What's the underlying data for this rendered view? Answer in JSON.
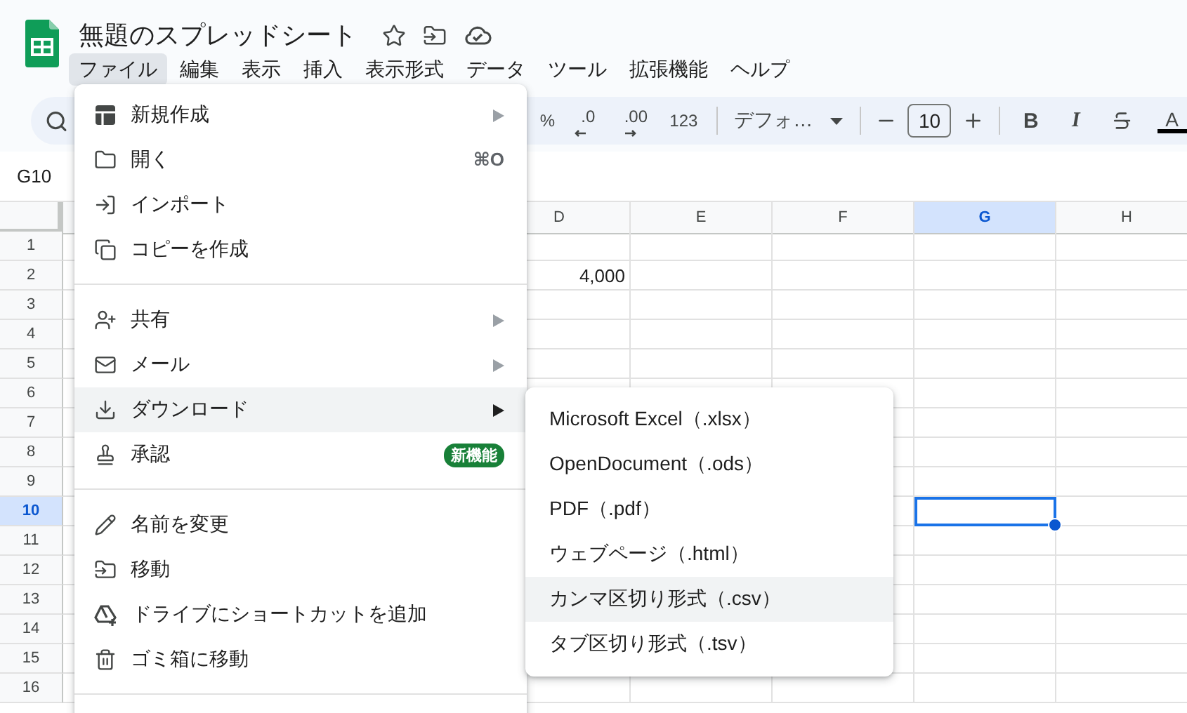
{
  "document": {
    "title": "無題のスプレッドシート"
  },
  "menu_bar": [
    {
      "label": "ファイル",
      "selected": true
    },
    {
      "label": "編集",
      "selected": false
    },
    {
      "label": "表示",
      "selected": false
    },
    {
      "label": "挿入",
      "selected": false
    },
    {
      "label": "表示形式",
      "selected": false
    },
    {
      "label": "データ",
      "selected": false
    },
    {
      "label": "ツール",
      "selected": false
    },
    {
      "label": "拡張機能",
      "selected": false
    },
    {
      "label": "ヘルプ",
      "selected": false
    }
  ],
  "toolbar": {
    "percent": "%",
    "decrease_decimals": ".0",
    "increase_decimals": ".00",
    "number_format": "123",
    "font": "デフォ…",
    "font_size": "10",
    "bold": "B",
    "italic": "I",
    "text_color": "A"
  },
  "name_box": "G10",
  "sheet": {
    "columns": [
      {
        "label": "D",
        "selected": false
      },
      {
        "label": "E",
        "selected": false
      },
      {
        "label": "F",
        "selected": false
      },
      {
        "label": "G",
        "selected": true
      },
      {
        "label": "H",
        "selected": false
      }
    ],
    "rows": [
      {
        "label": "1",
        "selected": false
      },
      {
        "label": "2",
        "selected": false,
        "cells": [
          "4,000"
        ]
      },
      {
        "label": "3",
        "selected": false
      },
      {
        "label": "4",
        "selected": false
      },
      {
        "label": "5",
        "selected": false
      },
      {
        "label": "6",
        "selected": false
      },
      {
        "label": "7",
        "selected": false
      },
      {
        "label": "8",
        "selected": false
      },
      {
        "label": "9",
        "selected": false
      },
      {
        "label": "10",
        "selected": true
      },
      {
        "label": "11",
        "selected": false
      },
      {
        "label": "12",
        "selected": false
      },
      {
        "label": "13",
        "selected": false
      },
      {
        "label": "14",
        "selected": false
      },
      {
        "label": "15",
        "selected": false
      },
      {
        "label": "16",
        "selected": false
      }
    ]
  },
  "file_menu": [
    {
      "kind": "item",
      "label": "新規作成",
      "submenu": true,
      "selected": false
    },
    {
      "kind": "item",
      "label": "開く",
      "shortcut": "⌘O",
      "selected": false
    },
    {
      "kind": "item",
      "label": "インポート",
      "selected": false
    },
    {
      "kind": "item",
      "label": "コピーを作成",
      "selected": false
    },
    {
      "kind": "divider"
    },
    {
      "kind": "item",
      "label": "共有",
      "submenu": true,
      "selected": false
    },
    {
      "kind": "item",
      "label": "メール",
      "submenu": true,
      "selected": false
    },
    {
      "kind": "item",
      "label": "ダウンロード",
      "submenu": true,
      "selected": true
    },
    {
      "kind": "item",
      "label": "承認",
      "badge": "新機能",
      "selected": false
    },
    {
      "kind": "divider"
    },
    {
      "kind": "item",
      "label": "名前を変更",
      "selected": false
    },
    {
      "kind": "item",
      "label": "移動",
      "selected": false
    },
    {
      "kind": "item",
      "label": "ドライブにショートカットを追加",
      "selected": false
    },
    {
      "kind": "item",
      "label": "ゴミ箱に移動",
      "selected": false
    },
    {
      "kind": "divider"
    }
  ],
  "download_menu": [
    {
      "label": "Microsoft Excel（.xlsx）",
      "selected": false
    },
    {
      "label": "OpenDocument（.ods）",
      "selected": false
    },
    {
      "label": "PDF（.pdf）",
      "selected": false
    },
    {
      "label": "ウェブページ（.html）",
      "selected": false
    },
    {
      "label": "カンマ区切り形式（.csv）",
      "selected": true
    },
    {
      "label": "タブ区切り形式（.tsv）",
      "selected": false
    }
  ]
}
